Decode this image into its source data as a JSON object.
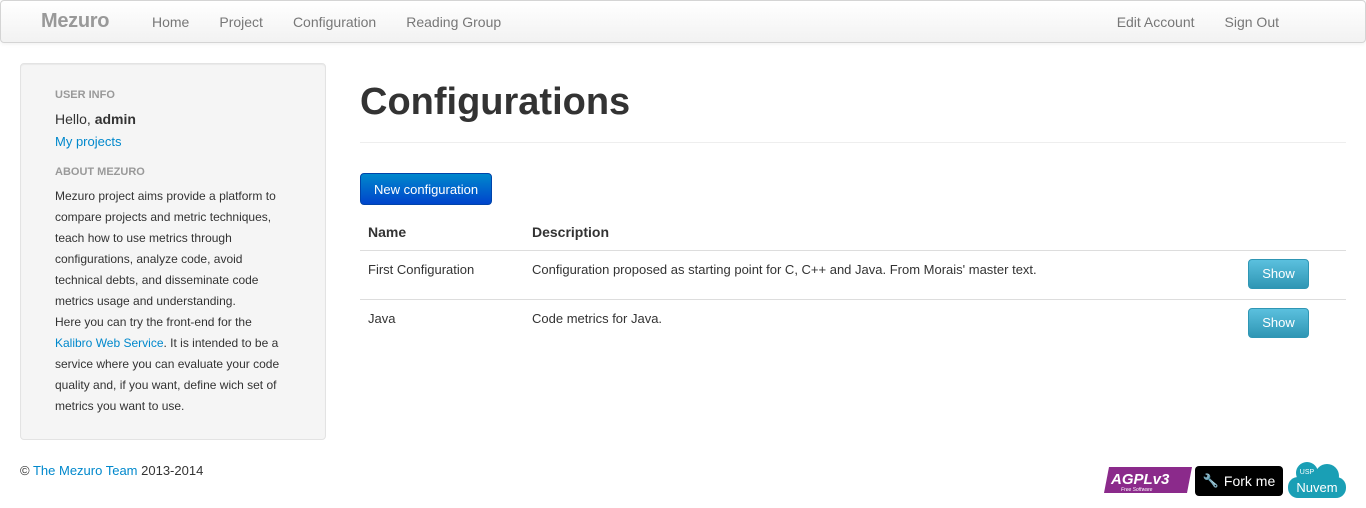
{
  "navbar": {
    "brand": "Mezuro",
    "left_links": [
      "Home",
      "Project",
      "Configuration",
      "Reading Group"
    ],
    "right_links": [
      "Edit Account",
      "Sign Out"
    ]
  },
  "sidebar": {
    "user_info_header": "USER INFO",
    "hello_prefix": "Hello, ",
    "username": "admin",
    "my_projects": "My projects",
    "about_header": "ABOUT MEZURO",
    "about_part1": "Mezuro project aims provide a platform to compare projects and metric techniques, teach how to use metrics through configurations, analyze code, avoid technical debts, and disseminate code metrics usage and understanding.",
    "about_part2": "Here you can try the front-end for the ",
    "about_link": "Kalibro Web Service",
    "about_part3": ". It is intended to be a service where you can evaluate your code quality and, if you want, define wich set of metrics you want to use."
  },
  "main": {
    "title": "Configurations",
    "new_button": "New configuration",
    "table": {
      "headers": [
        "Name",
        "Description"
      ],
      "rows": [
        {
          "name": "First Configuration",
          "description": "Configuration proposed as starting point for C, C++ and Java. From Morais' master text.",
          "action": "Show"
        },
        {
          "name": "Java",
          "description": "Code metrics for Java.",
          "action": "Show"
        }
      ]
    }
  },
  "footer": {
    "copyright": "©",
    "team_link": "The Mezuro Team",
    "years": "2013-2014",
    "agpl_text": "AGPLv3",
    "agpl_sub": "Free Software",
    "fork_label": "Fork me",
    "nuvem_top": "USP",
    "nuvem_label": "Nuvem"
  },
  "colors": {
    "link": "#0088cc",
    "primary_button": "#0066cc",
    "info_button": "#49afcd",
    "agpl_purple": "#8b2a8b",
    "nuvem_teal": "#1a9fb5"
  }
}
